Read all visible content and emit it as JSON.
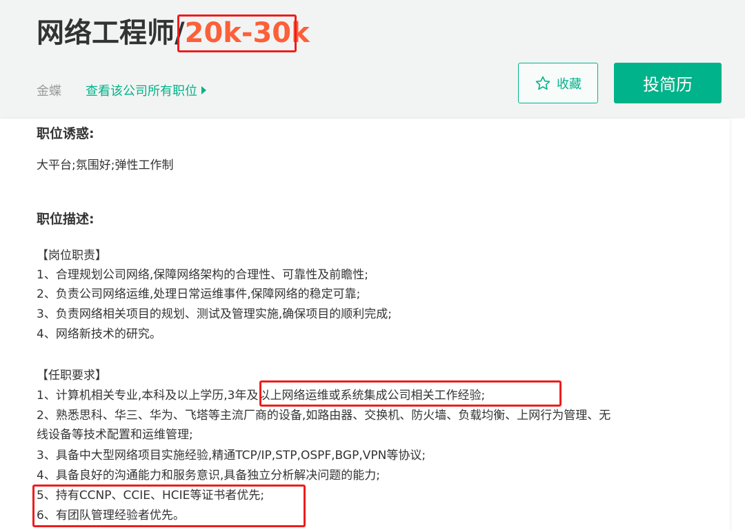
{
  "job": {
    "title_prefix": "网络工程师/",
    "salary": "20k-30k",
    "company": "金蝶",
    "all_jobs_link": "查看该公司所有职位",
    "favorite_label": "收藏",
    "apply_label": "投简历"
  },
  "colors": {
    "accent": "#00b38a",
    "salary": "#fd5f39",
    "highlight_box": "#ee1c1c"
  },
  "icons": {
    "favorite": "star-outline-icon",
    "link_arrow": "triangle-right-icon"
  },
  "perks": {
    "title": "职位诱惑:",
    "text": "大平台;氛围好;弹性工作制"
  },
  "description": {
    "title": "职位描述:",
    "duties_header": "【岗位职责】",
    "duties": [
      "1、合理规划公司网络,保障网络架构的合理性、可靠性及前瞻性;",
      "2、负责公司网络运维,处理日常运维事件,保障网络的稳定可靠;",
      "3、负责网络相关项目的规划、测试及管理实施,确保项目的顺利完成;",
      "4、网络新技术的研究。"
    ],
    "requirements_header": "【任职要求】",
    "req1_prefix": "1、计算机相关专业,本科及以上学历,",
    "req1_highlight": "3年及以上网络运维或系统集成公司相关工作经验;",
    "req2_line1": "2、熟悉思科、华三、华为、飞塔等主流厂商的设备,如路由器、交换机、防火墙、负载均衡、上网行为管理、无",
    "req2_line2": "线设备等技术配置和运维管理;",
    "req3": "3、具备中大型网络项目实施经验,精通TCP/IP,STP,OSPF,BGP,VPN等协议;",
    "req4": "4、具备良好的沟通能力和服务意识,具备独立分析解决问题的能力;",
    "req5": "5、持有CCNP、CCIE、HCIE等证书者优先;",
    "req6": "6、有团队管理经验者优先。"
  }
}
